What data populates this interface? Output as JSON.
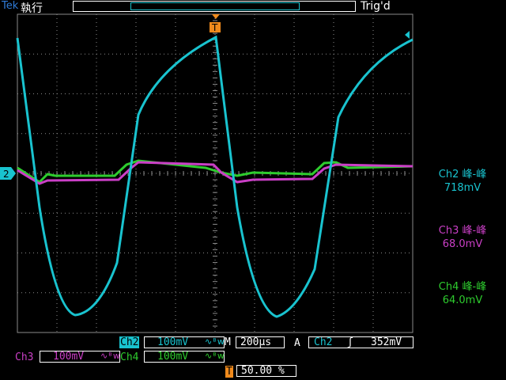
{
  "header": {
    "brand": "Tek",
    "run_state": "執行",
    "trigger_status": "Trig'd",
    "trigger_marker": "T"
  },
  "channel_marker": "2",
  "measurements": {
    "ch2": {
      "label": "Ch2 峰-峰",
      "value": "718mV"
    },
    "ch3": {
      "label": "Ch3 峰-峰",
      "value": "68.0mV"
    },
    "ch4": {
      "label": "Ch4 峰-峰",
      "value": "64.0mV"
    }
  },
  "settings": {
    "ch2": {
      "name": "Ch2",
      "scale": "100mV",
      "bw": "∿ᴮ𝗐"
    },
    "ch3": {
      "name": "Ch3",
      "scale": "100mV",
      "bw": "∿ᴮ𝗐"
    },
    "ch4": {
      "name": "Ch4",
      "scale": "100mV",
      "bw": "∿ᴮ𝗐"
    },
    "timebase": {
      "prefix": "M",
      "value": "200µs"
    },
    "trigger": {
      "mode": "A",
      "source": "Ch2",
      "slope": "ʃ",
      "level": "352mV"
    },
    "trigger_position": {
      "marker": "T",
      "value": "50.00 %"
    }
  },
  "colors": {
    "ch2": "#19c3cf",
    "ch3": "#ca3fc6",
    "ch4": "#2ecc2e",
    "grid": "#8a8a8a",
    "trigger": "#f08a1c"
  }
}
